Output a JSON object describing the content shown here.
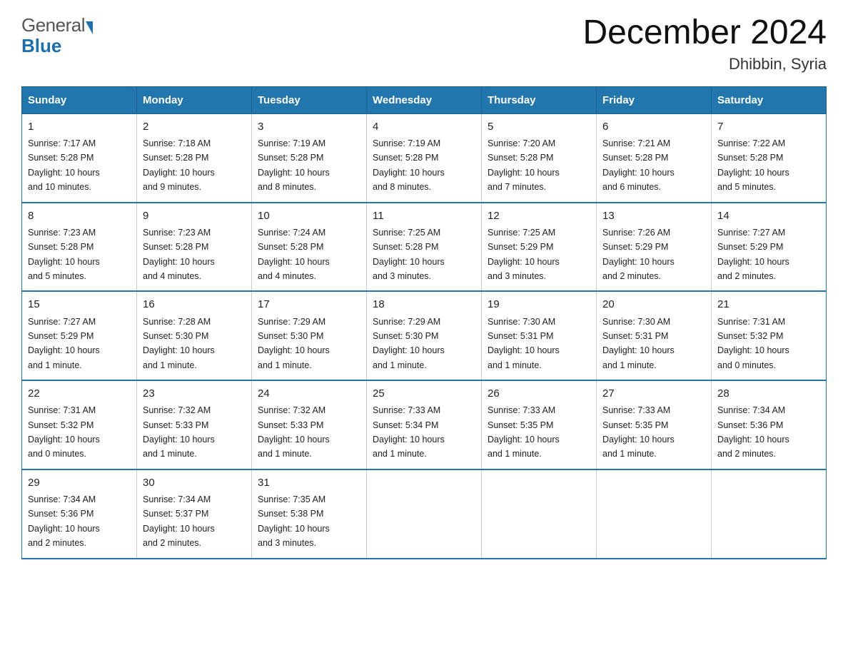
{
  "header": {
    "title": "December 2024",
    "subtitle": "Dhibbin, Syria",
    "logo_general": "General",
    "logo_blue": "Blue"
  },
  "columns": [
    "Sunday",
    "Monday",
    "Tuesday",
    "Wednesday",
    "Thursday",
    "Friday",
    "Saturday"
  ],
  "weeks": [
    [
      {
        "day": "1",
        "sunrise": "7:17 AM",
        "sunset": "5:28 PM",
        "daylight": "10 hours and 10 minutes."
      },
      {
        "day": "2",
        "sunrise": "7:18 AM",
        "sunset": "5:28 PM",
        "daylight": "10 hours and 9 minutes."
      },
      {
        "day": "3",
        "sunrise": "7:19 AM",
        "sunset": "5:28 PM",
        "daylight": "10 hours and 8 minutes."
      },
      {
        "day": "4",
        "sunrise": "7:19 AM",
        "sunset": "5:28 PM",
        "daylight": "10 hours and 8 minutes."
      },
      {
        "day": "5",
        "sunrise": "7:20 AM",
        "sunset": "5:28 PM",
        "daylight": "10 hours and 7 minutes."
      },
      {
        "day": "6",
        "sunrise": "7:21 AM",
        "sunset": "5:28 PM",
        "daylight": "10 hours and 6 minutes."
      },
      {
        "day": "7",
        "sunrise": "7:22 AM",
        "sunset": "5:28 PM",
        "daylight": "10 hours and 5 minutes."
      }
    ],
    [
      {
        "day": "8",
        "sunrise": "7:23 AM",
        "sunset": "5:28 PM",
        "daylight": "10 hours and 5 minutes."
      },
      {
        "day": "9",
        "sunrise": "7:23 AM",
        "sunset": "5:28 PM",
        "daylight": "10 hours and 4 minutes."
      },
      {
        "day": "10",
        "sunrise": "7:24 AM",
        "sunset": "5:28 PM",
        "daylight": "10 hours and 4 minutes."
      },
      {
        "day": "11",
        "sunrise": "7:25 AM",
        "sunset": "5:28 PM",
        "daylight": "10 hours and 3 minutes."
      },
      {
        "day": "12",
        "sunrise": "7:25 AM",
        "sunset": "5:29 PM",
        "daylight": "10 hours and 3 minutes."
      },
      {
        "day": "13",
        "sunrise": "7:26 AM",
        "sunset": "5:29 PM",
        "daylight": "10 hours and 2 minutes."
      },
      {
        "day": "14",
        "sunrise": "7:27 AM",
        "sunset": "5:29 PM",
        "daylight": "10 hours and 2 minutes."
      }
    ],
    [
      {
        "day": "15",
        "sunrise": "7:27 AM",
        "sunset": "5:29 PM",
        "daylight": "10 hours and 1 minute."
      },
      {
        "day": "16",
        "sunrise": "7:28 AM",
        "sunset": "5:30 PM",
        "daylight": "10 hours and 1 minute."
      },
      {
        "day": "17",
        "sunrise": "7:29 AM",
        "sunset": "5:30 PM",
        "daylight": "10 hours and 1 minute."
      },
      {
        "day": "18",
        "sunrise": "7:29 AM",
        "sunset": "5:30 PM",
        "daylight": "10 hours and 1 minute."
      },
      {
        "day": "19",
        "sunrise": "7:30 AM",
        "sunset": "5:31 PM",
        "daylight": "10 hours and 1 minute."
      },
      {
        "day": "20",
        "sunrise": "7:30 AM",
        "sunset": "5:31 PM",
        "daylight": "10 hours and 1 minute."
      },
      {
        "day": "21",
        "sunrise": "7:31 AM",
        "sunset": "5:32 PM",
        "daylight": "10 hours and 0 minutes."
      }
    ],
    [
      {
        "day": "22",
        "sunrise": "7:31 AM",
        "sunset": "5:32 PM",
        "daylight": "10 hours and 0 minutes."
      },
      {
        "day": "23",
        "sunrise": "7:32 AM",
        "sunset": "5:33 PM",
        "daylight": "10 hours and 1 minute."
      },
      {
        "day": "24",
        "sunrise": "7:32 AM",
        "sunset": "5:33 PM",
        "daylight": "10 hours and 1 minute."
      },
      {
        "day": "25",
        "sunrise": "7:33 AM",
        "sunset": "5:34 PM",
        "daylight": "10 hours and 1 minute."
      },
      {
        "day": "26",
        "sunrise": "7:33 AM",
        "sunset": "5:35 PM",
        "daylight": "10 hours and 1 minute."
      },
      {
        "day": "27",
        "sunrise": "7:33 AM",
        "sunset": "5:35 PM",
        "daylight": "10 hours and 1 minute."
      },
      {
        "day": "28",
        "sunrise": "7:34 AM",
        "sunset": "5:36 PM",
        "daylight": "10 hours and 2 minutes."
      }
    ],
    [
      {
        "day": "29",
        "sunrise": "7:34 AM",
        "sunset": "5:36 PM",
        "daylight": "10 hours and 2 minutes."
      },
      {
        "day": "30",
        "sunrise": "7:34 AM",
        "sunset": "5:37 PM",
        "daylight": "10 hours and 2 minutes."
      },
      {
        "day": "31",
        "sunrise": "7:35 AM",
        "sunset": "5:38 PM",
        "daylight": "10 hours and 3 minutes."
      },
      null,
      null,
      null,
      null
    ]
  ],
  "labels": {
    "sunrise": "Sunrise:",
    "sunset": "Sunset:",
    "daylight": "Daylight:"
  }
}
